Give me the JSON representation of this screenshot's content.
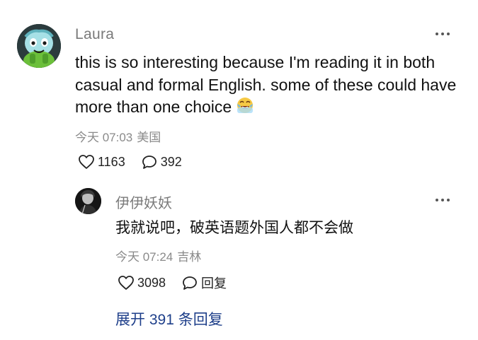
{
  "comment": {
    "author": "Laura",
    "text": "this is so interesting because I'm reading it in both casual and formal English. some of these could have more than one choice",
    "emoji": "crying-laughing-emoji",
    "time": "今天 07:03",
    "location": "美国",
    "likes": "1163",
    "replies": "392"
  },
  "reply": {
    "author": "伊伊妖妖",
    "text": "我就说吧，破英语题外国人都不会做",
    "time": "今天 07:24",
    "location": "吉林",
    "likes": "3098",
    "reply_label": "回复"
  },
  "expand_label": "展开 391 条回复",
  "colors": {
    "meta": "#8a8a8a",
    "author": "#7a7a7a",
    "link": "#1e3f8a"
  }
}
